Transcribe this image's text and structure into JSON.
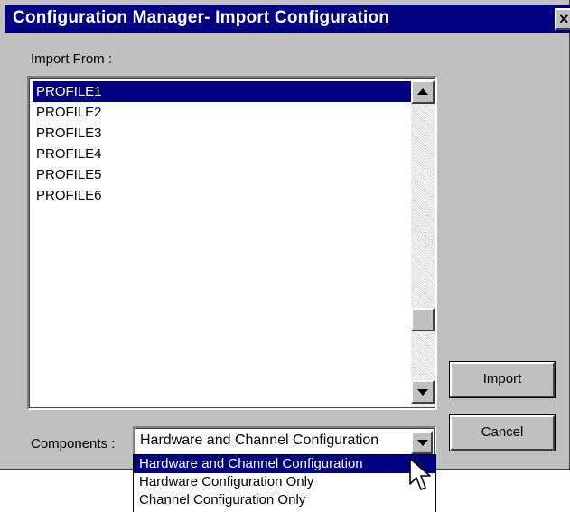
{
  "window": {
    "title": "Configuration Manager- Import Configuration",
    "close_label": "×"
  },
  "import_from": {
    "label": "Import From :",
    "items": [
      "PROFILE1",
      "PROFILE2",
      "PROFILE3",
      "PROFILE4",
      "PROFILE5",
      "PROFILE6"
    ],
    "selected": "PROFILE1"
  },
  "buttons": {
    "import_label": "Import",
    "cancel_label": "Cancel"
  },
  "components": {
    "label": "Components :",
    "value": "Hardware and Channel Configuration",
    "options": [
      "Hardware and Channel Configuration",
      "Hardware Configuration Only",
      "Channel Configuration Only"
    ],
    "highlighted": "Hardware and Channel Configuration"
  },
  "colors": {
    "titlebar": "#000080",
    "selection": "#000080",
    "dialog_face": "#c0c0c0"
  },
  "icons": [
    "close-icon",
    "scroll-up-icon",
    "scroll-down-icon",
    "dropdown-arrow-icon",
    "mouse-pointer-icon"
  ]
}
